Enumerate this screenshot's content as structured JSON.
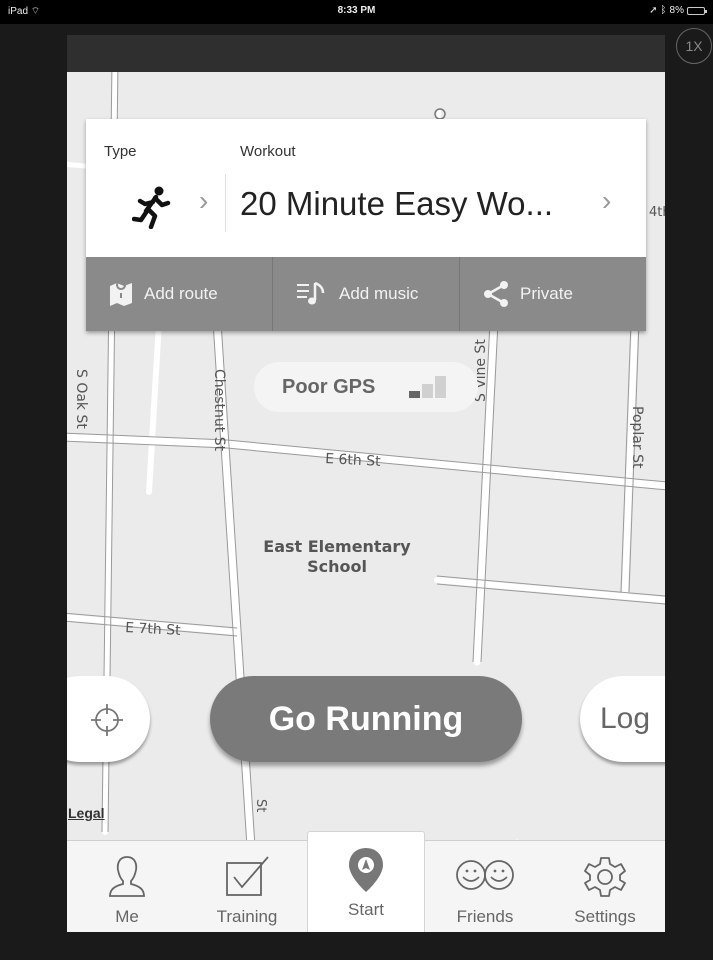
{
  "status_bar": {
    "device": "iPad",
    "time": "8:33 PM",
    "battery": "8%"
  },
  "zoom_label": "1X",
  "workout_card": {
    "type_label": "Type",
    "workout_label": "Workout",
    "activity_icon": "running-person-icon",
    "workout_name": "20 Minute Easy Wo...",
    "actions": [
      {
        "label": "Add route",
        "icon": "map-icon"
      },
      {
        "label": "Add music",
        "icon": "music-list-icon"
      },
      {
        "label": "Private",
        "icon": "share-icon"
      }
    ]
  },
  "gps": {
    "label": "Poor GPS",
    "icon": "signal-bars-icon"
  },
  "map": {
    "streets": [
      "S Oak St",
      "Chestnut St",
      "S Vine St",
      "Poplar St",
      "E 6th St",
      "E 7th St",
      "4th",
      "St"
    ],
    "places": [
      "East Elementary",
      "School"
    ]
  },
  "buttons": {
    "locate_icon": "crosshair-icon",
    "go": "Go Running",
    "log": "Log"
  },
  "legal": "Legal",
  "tabs": [
    {
      "label": "Me",
      "icon": "person-icon"
    },
    {
      "label": "Training",
      "icon": "checkbox-icon"
    },
    {
      "label": "Start",
      "icon": "location-pin-icon",
      "active": true
    },
    {
      "label": "Friends",
      "icon": "smiley-faces-icon"
    },
    {
      "label": "Settings",
      "icon": "gear-icon"
    }
  ],
  "colors": {
    "action_bar": "#8a8a8a",
    "go_button": "#7a7a7a",
    "header": "#2f2f2f",
    "map": "#ebebeb"
  }
}
